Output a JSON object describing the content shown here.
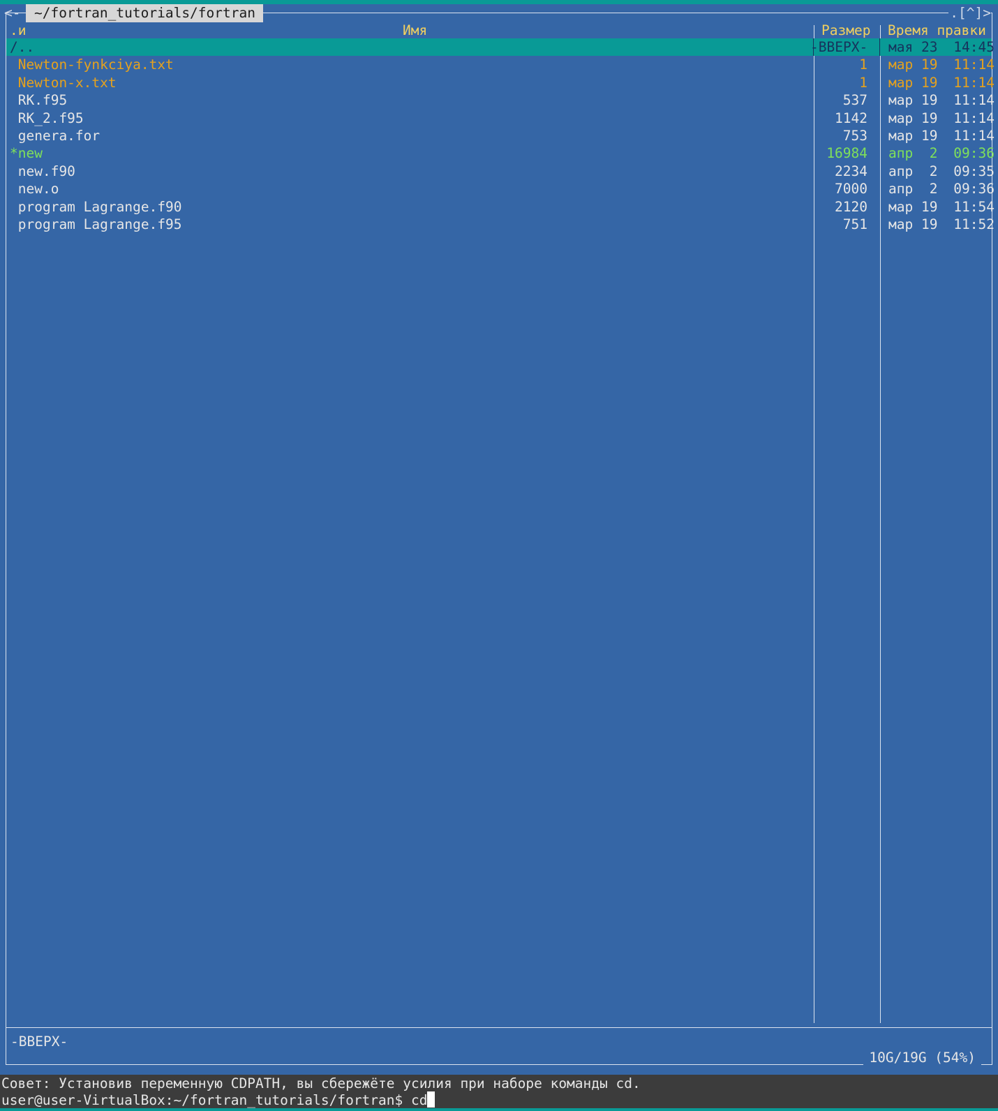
{
  "panel": {
    "path": "~/fortran_tutorials/fortran",
    "left_corner": "<-",
    "right_corner": ".[^]>",
    "headers": {
      "sort": ".и",
      "name": "Имя",
      "size": "Размер",
      "mtime": "Время правки"
    },
    "files": [
      {
        "name": "/..",
        "size": "-ВВЕРХ-",
        "date": "мая 23",
        "time": "14:45",
        "kind": "updir",
        "selected": true
      },
      {
        "name": " Newton-fynkciya.txt",
        "size": "1",
        "date": "мар 19",
        "time": "11:14",
        "kind": "txt",
        "selected": false
      },
      {
        "name": " Newton-x.txt",
        "size": "1",
        "date": "мар 19",
        "time": "11:14",
        "kind": "txt",
        "selected": false
      },
      {
        "name": " RK.f95",
        "size": "537",
        "date": "мар 19",
        "time": "11:14",
        "kind": "normal",
        "selected": false
      },
      {
        "name": " RK_2.f95",
        "size": "1142",
        "date": "мар 19",
        "time": "11:14",
        "kind": "normal",
        "selected": false
      },
      {
        "name": " genera.for",
        "size": "753",
        "date": "мар 19",
        "time": "11:14",
        "kind": "normal",
        "selected": false
      },
      {
        "name": "*new",
        "size": "16984",
        "date": "апр  2",
        "time": "09:36",
        "kind": "exec",
        "selected": false
      },
      {
        "name": " new.f90",
        "size": "2234",
        "date": "апр  2",
        "time": "09:35",
        "kind": "normal",
        "selected": false
      },
      {
        "name": " new.o",
        "size": "7000",
        "date": "апр  2",
        "time": "09:36",
        "kind": "normal",
        "selected": false
      },
      {
        "name": " program Lagrange.f90",
        "size": "2120",
        "date": "мар 19",
        "time": "11:54",
        "kind": "normal",
        "selected": false
      },
      {
        "name": " program Lagrange.f95",
        "size": "751",
        "date": "мар 19",
        "time": "11:52",
        "kind": "normal",
        "selected": false
      }
    ],
    "status": "-ВВЕРХ-",
    "disk_usage": "10G/19G (54%)"
  },
  "hint": "Совет: Установив переменную CDPATH, вы сбережёте усилия при наборе команды cd.",
  "prompt": "user@user-VirtualBox:~/fortran_tutorials/fortran$ cd",
  "colors": {
    "panel_bg": "#3566a6",
    "selection_bg": "#099a96",
    "header": "#f2d05e",
    "txt_file": "#e6a21d",
    "exec_file": "#7fe05a"
  }
}
